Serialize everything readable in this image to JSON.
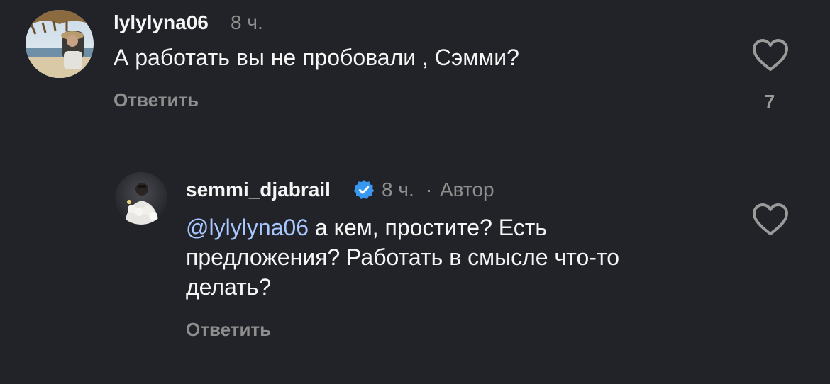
{
  "comments": [
    {
      "username": "lylylyna06",
      "time": "8 ч.",
      "text": "А работать вы не пробовали , Сэмми?",
      "reply_label": "Ответить",
      "like_count": "7",
      "avatar_icon": "beach-photo-avatar",
      "like_icon": "heart-outline-icon"
    },
    {
      "username": "semmi_djabrail",
      "time": "8 ч.",
      "separator": "·",
      "author_label": "Автор",
      "verified_icon": "verified-badge-icon",
      "mention": "@lylylyna06",
      "text_line1": " а кем, простите? Есть",
      "text_line2": "предложения? Работать в смысле что-то",
      "text_line3": "делать?",
      "reply_label": "Ответить",
      "avatar_icon": "person-photo-avatar",
      "like_icon": "heart-outline-icon"
    }
  ],
  "colors": {
    "background": "#212328",
    "primary_text": "#f5f5f5",
    "secondary_text": "#8e8e8e",
    "mention": "#a9c7ff",
    "verified": "#3897f0"
  }
}
